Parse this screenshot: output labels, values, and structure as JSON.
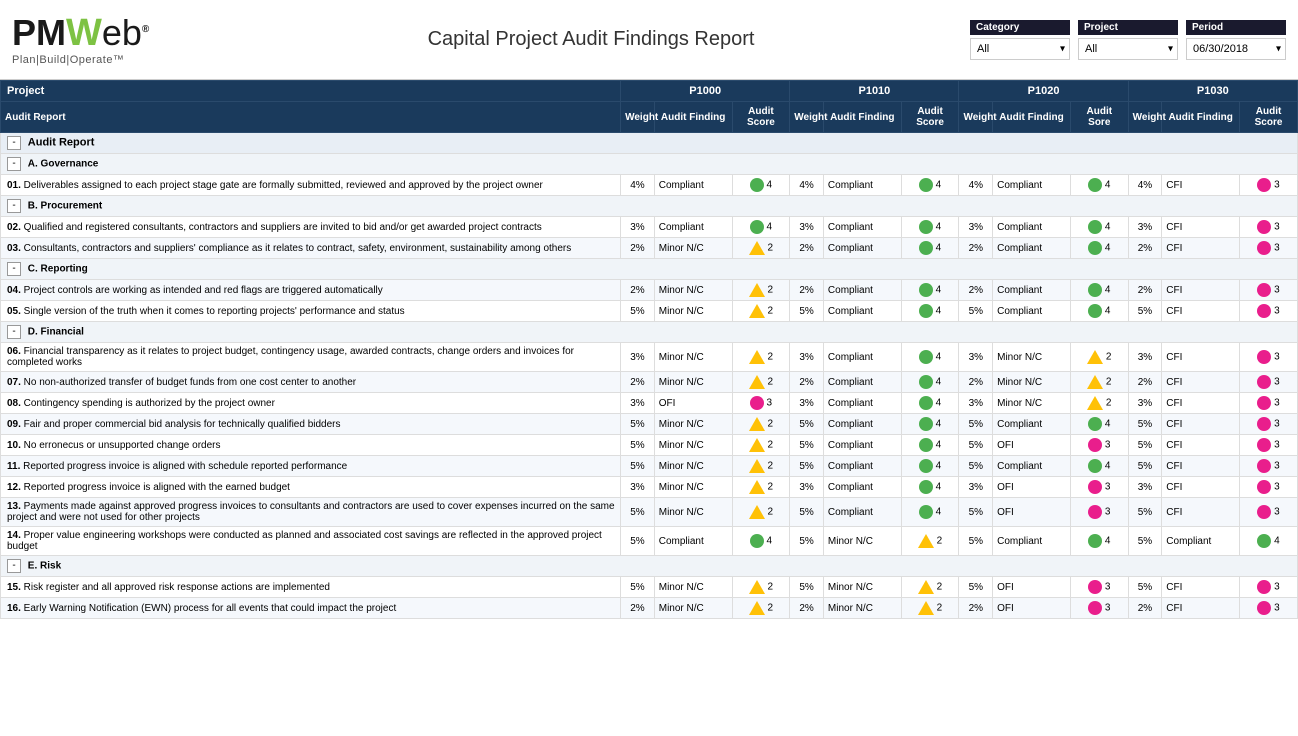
{
  "logo": {
    "pm": "PM",
    "slash": "/",
    "web": "Web",
    "registered": "®",
    "subtitle": "Plan|Build|Operate™"
  },
  "report": {
    "title": "Capital Project Audit Findings Report"
  },
  "filters": {
    "category": {
      "label": "Category",
      "value": "All"
    },
    "project": {
      "label": "Project",
      "value": "All"
    },
    "period": {
      "label": "Period",
      "value": "06/30/2018"
    }
  },
  "table": {
    "project_col": "Project",
    "audit_report_col": "Audit Report",
    "projects": [
      {
        "id": "P1000",
        "weight_col": "Weight",
        "finding_col": "Audit Finding",
        "score_col": "Audit Score"
      },
      {
        "id": "P1010",
        "weight_col": "Weight",
        "finding_col": "Audit Finding",
        "score_col": "Audit Score"
      },
      {
        "id": "P1020",
        "weight_col": "Weight",
        "finding_col": "Audit Finding",
        "score_col": "Audit Sore"
      },
      {
        "id": "P1030",
        "weight_col": "Weight",
        "finding_col": "Audit Finding",
        "score_col": "Audit Score"
      }
    ],
    "sections": [
      {
        "id": "audit-report",
        "label": "Audit Report",
        "collapsed": false,
        "categories": [
          {
            "id": "governance",
            "label": "A. Governance",
            "collapsed": false,
            "items": [
              {
                "num": "01.",
                "text": "Deliverables assigned to each project stage gate are formally submitted, reviewed and approved by the project owner",
                "p1000": {
                  "weight": "4%",
                  "finding": "Compliant",
                  "indicator": "green",
                  "score": "4"
                },
                "p1010": {
                  "weight": "4%",
                  "finding": "Compliant",
                  "indicator": "green",
                  "score": "4"
                },
                "p1020": {
                  "weight": "4%",
                  "finding": "Compliant",
                  "indicator": "green",
                  "score": "4"
                },
                "p1030": {
                  "weight": "4%",
                  "finding": "CFI",
                  "indicator": "pink",
                  "score": "3"
                }
              }
            ]
          },
          {
            "id": "procurement",
            "label": "B. Procurement",
            "collapsed": false,
            "items": [
              {
                "num": "02.",
                "text": "Qualified and registered consultants, contractors and suppliers are invited to bid and/or get awarded project contracts",
                "p1000": {
                  "weight": "3%",
                  "finding": "Compliant",
                  "indicator": "green",
                  "score": "4"
                },
                "p1010": {
                  "weight": "3%",
                  "finding": "Compliant",
                  "indicator": "green",
                  "score": "4"
                },
                "p1020": {
                  "weight": "3%",
                  "finding": "Compliant",
                  "indicator": "green",
                  "score": "4"
                },
                "p1030": {
                  "weight": "3%",
                  "finding": "CFI",
                  "indicator": "pink",
                  "score": "3"
                }
              },
              {
                "num": "03.",
                "text": "Consultants, contractors and suppliers' compliance as it relates to contract, safety, environment, sustainability among others",
                "p1000": {
                  "weight": "2%",
                  "finding": "Minor N/C",
                  "indicator": "triangle",
                  "score": "2"
                },
                "p1010": {
                  "weight": "2%",
                  "finding": "Compliant",
                  "indicator": "green",
                  "score": "4"
                },
                "p1020": {
                  "weight": "2%",
                  "finding": "Compliant",
                  "indicator": "green",
                  "score": "4"
                },
                "p1030": {
                  "weight": "2%",
                  "finding": "CFI",
                  "indicator": "pink",
                  "score": "3"
                }
              }
            ]
          },
          {
            "id": "reporting",
            "label": "C. Reporting",
            "collapsed": false,
            "items": [
              {
                "num": "04.",
                "text": "Project controls are working as intended and red flags are triggered automatically",
                "p1000": {
                  "weight": "2%",
                  "finding": "Minor N/C",
                  "indicator": "triangle",
                  "score": "2"
                },
                "p1010": {
                  "weight": "2%",
                  "finding": "Compliant",
                  "indicator": "green",
                  "score": "4"
                },
                "p1020": {
                  "weight": "2%",
                  "finding": "Compliant",
                  "indicator": "green",
                  "score": "4"
                },
                "p1030": {
                  "weight": "2%",
                  "finding": "CFI",
                  "indicator": "pink",
                  "score": "3"
                }
              },
              {
                "num": "05.",
                "text": "Single version of the truth when it comes to reporting projects' performance and status",
                "p1000": {
                  "weight": "5%",
                  "finding": "Minor N/C",
                  "indicator": "triangle",
                  "score": "2"
                },
                "p1010": {
                  "weight": "5%",
                  "finding": "Compliant",
                  "indicator": "green",
                  "score": "4"
                },
                "p1020": {
                  "weight": "5%",
                  "finding": "Compliant",
                  "indicator": "green",
                  "score": "4"
                },
                "p1030": {
                  "weight": "5%",
                  "finding": "CFI",
                  "indicator": "pink",
                  "score": "3"
                }
              }
            ]
          },
          {
            "id": "financial",
            "label": "D. Financial",
            "collapsed": false,
            "items": [
              {
                "num": "06.",
                "text": "Financial transparency as it relates to project budget, contingency usage, awarded contracts, change orders and invoices for completed works",
                "p1000": {
                  "weight": "3%",
                  "finding": "Minor N/C",
                  "indicator": "triangle",
                  "score": "2"
                },
                "p1010": {
                  "weight": "3%",
                  "finding": "Compliant",
                  "indicator": "green",
                  "score": "4"
                },
                "p1020": {
                  "weight": "3%",
                  "finding": "Minor N/C",
                  "indicator": "triangle",
                  "score": "2"
                },
                "p1030": {
                  "weight": "3%",
                  "finding": "CFI",
                  "indicator": "pink",
                  "score": "3"
                }
              },
              {
                "num": "07.",
                "text": "No non-authorized transfer of budget funds from one cost center to another",
                "p1000": {
                  "weight": "2%",
                  "finding": "Minor N/C",
                  "indicator": "triangle",
                  "score": "2"
                },
                "p1010": {
                  "weight": "2%",
                  "finding": "Compliant",
                  "indicator": "green",
                  "score": "4"
                },
                "p1020": {
                  "weight": "2%",
                  "finding": "Minor N/C",
                  "indicator": "triangle",
                  "score": "2"
                },
                "p1030": {
                  "weight": "2%",
                  "finding": "CFI",
                  "indicator": "pink",
                  "score": "3"
                }
              },
              {
                "num": "08.",
                "text": "Contingency spending is authorized by the project owner",
                "p1000": {
                  "weight": "3%",
                  "finding": "OFI",
                  "indicator": "pink",
                  "score": "3"
                },
                "p1010": {
                  "weight": "3%",
                  "finding": "Compliant",
                  "indicator": "green",
                  "score": "4"
                },
                "p1020": {
                  "weight": "3%",
                  "finding": "Minor N/C",
                  "indicator": "triangle",
                  "score": "2"
                },
                "p1030": {
                  "weight": "3%",
                  "finding": "CFI",
                  "indicator": "pink",
                  "score": "3"
                }
              },
              {
                "num": "09.",
                "text": "Fair and proper commercial bid analysis for technically qualified bidders",
                "p1000": {
                  "weight": "5%",
                  "finding": "Minor N/C",
                  "indicator": "triangle",
                  "score": "2"
                },
                "p1010": {
                  "weight": "5%",
                  "finding": "Compliant",
                  "indicator": "green",
                  "score": "4"
                },
                "p1020": {
                  "weight": "5%",
                  "finding": "Compliant",
                  "indicator": "green",
                  "score": "4"
                },
                "p1030": {
                  "weight": "5%",
                  "finding": "CFI",
                  "indicator": "pink",
                  "score": "3"
                }
              },
              {
                "num": "10.",
                "text": "No erronecus or unsupported change orders",
                "p1000": {
                  "weight": "5%",
                  "finding": "Minor N/C",
                  "indicator": "triangle",
                  "score": "2"
                },
                "p1010": {
                  "weight": "5%",
                  "finding": "Compliant",
                  "indicator": "green",
                  "score": "4"
                },
                "p1020": {
                  "weight": "5%",
                  "finding": "OFI",
                  "indicator": "pink",
                  "score": "3"
                },
                "p1030": {
                  "weight": "5%",
                  "finding": "CFI",
                  "indicator": "pink",
                  "score": "3"
                }
              },
              {
                "num": "11.",
                "text": "Reported progress invoice is aligned with schedule reported performance",
                "p1000": {
                  "weight": "5%",
                  "finding": "Minor N/C",
                  "indicator": "triangle",
                  "score": "2"
                },
                "p1010": {
                  "weight": "5%",
                  "finding": "Compliant",
                  "indicator": "green",
                  "score": "4"
                },
                "p1020": {
                  "weight": "5%",
                  "finding": "Compliant",
                  "indicator": "green",
                  "score": "4"
                },
                "p1030": {
                  "weight": "5%",
                  "finding": "CFI",
                  "indicator": "pink",
                  "score": "3"
                }
              },
              {
                "num": "12.",
                "text": "Reported progress invoice is aligned with the earned budget",
                "p1000": {
                  "weight": "3%",
                  "finding": "Minor N/C",
                  "indicator": "triangle",
                  "score": "2"
                },
                "p1010": {
                  "weight": "3%",
                  "finding": "Compliant",
                  "indicator": "green",
                  "score": "4"
                },
                "p1020": {
                  "weight": "3%",
                  "finding": "OFI",
                  "indicator": "pink",
                  "score": "3"
                },
                "p1030": {
                  "weight": "3%",
                  "finding": "CFI",
                  "indicator": "pink",
                  "score": "3"
                }
              },
              {
                "num": "13.",
                "text": "Payments made against approved progress invoices to consultants and contractors are used to cover expenses incurred on the same project and were not used for other projects",
                "p1000": {
                  "weight": "5%",
                  "finding": "Minor N/C",
                  "indicator": "triangle",
                  "score": "2"
                },
                "p1010": {
                  "weight": "5%",
                  "finding": "Compliant",
                  "indicator": "green",
                  "score": "4"
                },
                "p1020": {
                  "weight": "5%",
                  "finding": "OFI",
                  "indicator": "pink",
                  "score": "3"
                },
                "p1030": {
                  "weight": "5%",
                  "finding": "CFI",
                  "indicator": "pink",
                  "score": "3"
                }
              },
              {
                "num": "14.",
                "text": "Proper value engineering workshops were conducted as planned and associated cost savings are reflected in the approved project budget",
                "p1000": {
                  "weight": "5%",
                  "finding": "Compliant",
                  "indicator": "green",
                  "score": "4"
                },
                "p1010": {
                  "weight": "5%",
                  "finding": "Minor N/C",
                  "indicator": "triangle",
                  "score": "2"
                },
                "p1020": {
                  "weight": "5%",
                  "finding": "Compliant",
                  "indicator": "green",
                  "score": "4"
                },
                "p1030": {
                  "weight": "5%",
                  "finding": "Compliant",
                  "indicator": "green",
                  "score": "4"
                }
              }
            ]
          },
          {
            "id": "risk",
            "label": "E. Risk",
            "collapsed": false,
            "items": [
              {
                "num": "15.",
                "text": "Risk register and all approved risk response actions are implemented",
                "p1000": {
                  "weight": "5%",
                  "finding": "Minor N/C",
                  "indicator": "triangle",
                  "score": "2"
                },
                "p1010": {
                  "weight": "5%",
                  "finding": "Minor N/C",
                  "indicator": "triangle",
                  "score": "2"
                },
                "p1020": {
                  "weight": "5%",
                  "finding": "OFI",
                  "indicator": "pink",
                  "score": "3"
                },
                "p1030": {
                  "weight": "5%",
                  "finding": "CFI",
                  "indicator": "pink",
                  "score": "3"
                }
              },
              {
                "num": "16.",
                "text": "Early Warning Notification (EWN) process for all events that could impact the project",
                "p1000": {
                  "weight": "2%",
                  "finding": "Minor N/C",
                  "indicator": "triangle",
                  "score": "2"
                },
                "p1010": {
                  "weight": "2%",
                  "finding": "Minor N/C",
                  "indicator": "triangle",
                  "score": "2"
                },
                "p1020": {
                  "weight": "2%",
                  "finding": "OFI",
                  "indicator": "pink",
                  "score": "3"
                },
                "p1030": {
                  "weight": "2%",
                  "finding": "CFI",
                  "indicator": "pink",
                  "score": "3"
                }
              }
            ]
          }
        ]
      }
    ]
  }
}
